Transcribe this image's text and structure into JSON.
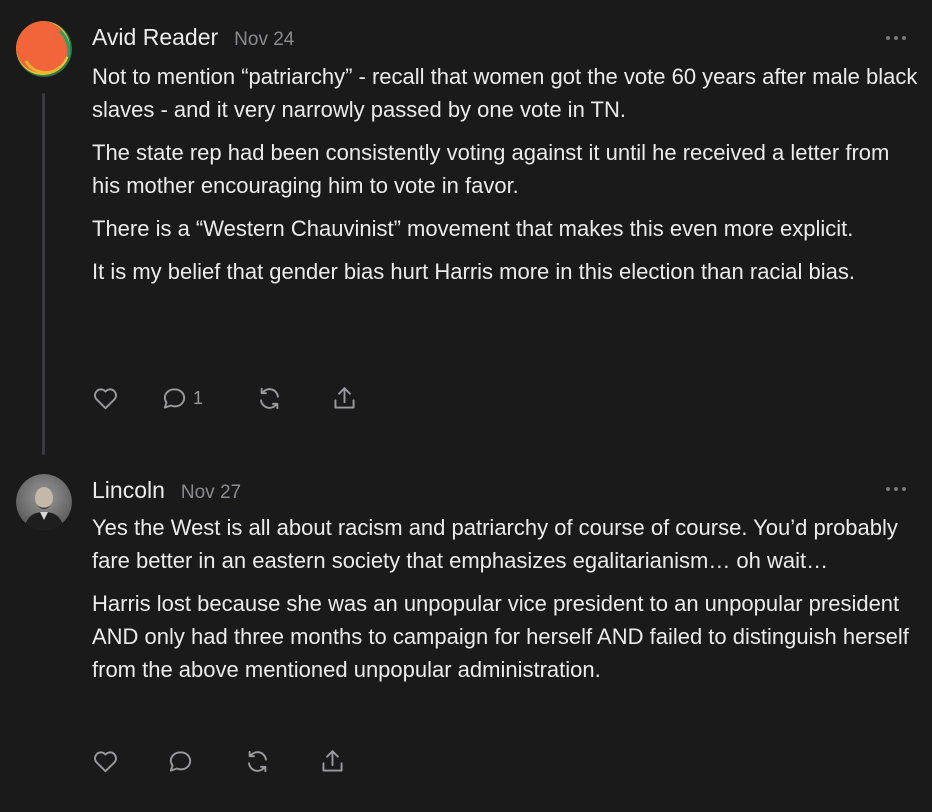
{
  "comments": [
    {
      "author": "Avid Reader",
      "date": "Nov 24",
      "paragraphs": [
        "Not to mention “patriarchy” - recall that women got the vote 60 years after male black slaves - and it very narrowly passed by one vote in TN.",
        "The state rep had been consistently voting against it until he received a letter from his mother encouraging him to vote in favor.",
        "There is a “Western Chauvinist” movement that makes this even more explicit.",
        "It is my belief that gender bias hurt Harris more in this election than racial bias."
      ],
      "reply_count": "1",
      "avatar_icon": "orange-circle-avatar"
    },
    {
      "author": "Lincoln",
      "date": "Nov 27",
      "paragraphs": [
        "Yes the West is all about racism and patriarchy of course of course. You’d probably fare better in an eastern society that emphasizes egalitarianism… oh wait…",
        "Harris lost because she was an unpopular vice president to an unpopular president AND only had three months to campaign for herself AND failed to distinguish herself from the above mentioned unpopular administration."
      ],
      "reply_count": "",
      "avatar_icon": "portrait-avatar"
    }
  ],
  "colors": {
    "background": "#1a1a1b",
    "text": "#ebebeb",
    "muted": "#8b8b8f",
    "icon": "#9a9a9e",
    "thread_line": "#3a3a3c",
    "avatar_orange": "#f2643a"
  },
  "icons": [
    "heart-icon",
    "comment-icon",
    "restack-icon",
    "share-icon",
    "more-icon"
  ]
}
